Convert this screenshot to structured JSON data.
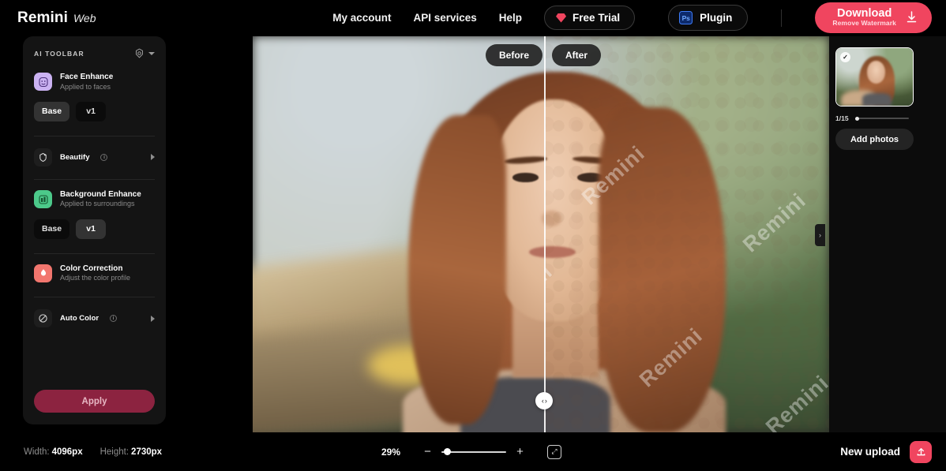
{
  "brand": {
    "name": "Remini",
    "suffix": "Web"
  },
  "topnav": {
    "links": [
      {
        "label": "My account",
        "name": "my-account"
      },
      {
        "label": "API services",
        "name": "api-services"
      },
      {
        "label": "Help",
        "name": "help"
      }
    ],
    "free_trial": {
      "label": "Free Trial",
      "icon": "gem-icon"
    },
    "plugin": {
      "label": "Plugin",
      "badge": "Ps"
    },
    "download": {
      "main": "Download",
      "sub": "Remove Watermark",
      "icon": "download-icon"
    }
  },
  "sidebar": {
    "title": "AI TOOLBAR",
    "settings_icon": "gear-icon",
    "tools": [
      {
        "name": "Face Enhance",
        "desc": "Applied to faces",
        "icon": "face-icon",
        "icon_color": "#cbb2f2",
        "variants": [
          {
            "label": "Base",
            "selected": true
          },
          {
            "label": "v1",
            "selected": false
          }
        ]
      },
      {
        "name": "Background Enhance",
        "desc": "Applied to surroundings",
        "icon": "building-icon",
        "icon_color": "#4cc98a",
        "variants": [
          {
            "label": "Base",
            "selected": false
          },
          {
            "label": "v1",
            "selected": true
          }
        ]
      },
      {
        "name": "Color Correction",
        "desc": "Adjust the color profile",
        "icon": "droplet-icon",
        "icon_color": "#f2766e",
        "variants": []
      }
    ],
    "options": [
      {
        "label": "Beautify",
        "icon": "sparkle-icon",
        "info": "i"
      },
      {
        "label": "Auto Color",
        "icon": "no-color-icon",
        "info": "i"
      }
    ],
    "apply_label": "Apply"
  },
  "canvas": {
    "before_label": "Before",
    "after_label": "After",
    "watermark": "Remini",
    "handle_left_icon": "chevron-left-icon",
    "handle_right_icon": "chevron-right-icon"
  },
  "right_panel": {
    "counter": "1/15",
    "add_photos_label": "Add photos",
    "thumb_check": "✓",
    "collapse_icon": "chevron-right-icon"
  },
  "bottom": {
    "width_key": "Width:",
    "width_val": "4096px",
    "height_key": "Height:",
    "height_val": "2730px",
    "zoom_value": "29%",
    "zoom_out": "−",
    "zoom_in": "+",
    "fit_icon": "fit-screen-icon",
    "new_upload_label": "New upload",
    "upload_icon": "upload-icon"
  },
  "colors": {
    "accent": "#f0455f",
    "apply": "#8c2340",
    "face": "#cbb2f2",
    "bg_enhance": "#4cc98a",
    "color_corr": "#f2766e"
  }
}
